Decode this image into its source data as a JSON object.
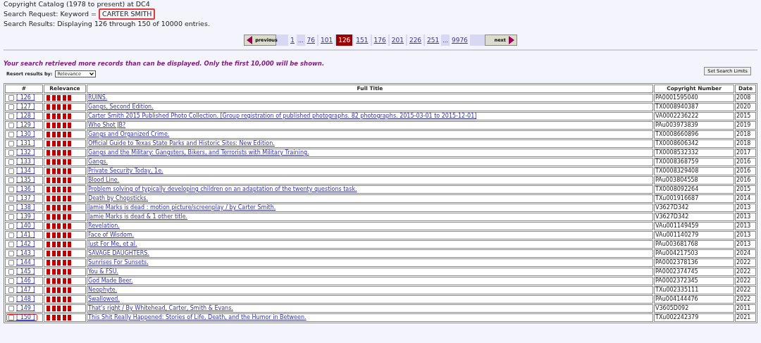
{
  "header": {
    "catalog": "Copyright Catalog (1978 to present) at DC4",
    "request_label": "Search Request: Keyword =",
    "keyword": "CARTER SMITH",
    "keyword_highlighted": true,
    "results": "Search Results: Displaying 126 through 150 of 10000 entries."
  },
  "pagination": {
    "previous": "previous",
    "next": "next",
    "pages": [
      {
        "label": "1",
        "kind": "link",
        "selected": false
      },
      {
        "label": "...",
        "kind": "gap"
      },
      {
        "label": "76",
        "kind": "link",
        "selected": false
      },
      {
        "label": "101",
        "kind": "link",
        "selected": false
      },
      {
        "label": "126",
        "kind": "link",
        "selected": true
      },
      {
        "label": "151",
        "kind": "link",
        "selected": false
      },
      {
        "label": "176",
        "kind": "link",
        "selected": false
      },
      {
        "label": "201",
        "kind": "link",
        "selected": false
      },
      {
        "label": "226",
        "kind": "link",
        "selected": false
      },
      {
        "label": "251",
        "kind": "link",
        "selected": false
      },
      {
        "label": "...",
        "kind": "gap"
      },
      {
        "label": "9976",
        "kind": "link",
        "selected": false
      }
    ]
  },
  "notice": "Your search retrieved more records than can be displayed. Only the first 10,000 will be shown.",
  "resort": {
    "label": "Resort results by:",
    "value": "Relevance"
  },
  "limits_button": "Set Search Limits",
  "table": {
    "columns": [
      "#",
      "Relevance",
      "Full Title",
      "Copyright Number",
      "Date"
    ],
    "rows": [
      {
        "num": "[ 126 ]",
        "checked": false,
        "highlighted": false,
        "stars": 5,
        "title": "RUINS.",
        "number": "PA0001595040",
        "date": "2008"
      },
      {
        "num": "[ 127 ]",
        "checked": false,
        "highlighted": false,
        "stars": 5,
        "title": "Gangs, Second Edition.",
        "number": "TX0008940387",
        "date": "2020"
      },
      {
        "num": "[ 128 ]",
        "checked": false,
        "highlighted": false,
        "stars": 5,
        "title": "Carter Smith 2015 Published Photo Collection. [Group registration of published photographs. 82 photographs. 2015-03-01 to 2015-12-01]",
        "number": "VA0002236222",
        "date": "2015"
      },
      {
        "num": "[ 129 ]",
        "checked": false,
        "highlighted": false,
        "stars": 5,
        "title": "Who Shot JB?",
        "number": "PAu003973839",
        "date": "2019"
      },
      {
        "num": "[ 130 ]",
        "checked": false,
        "highlighted": false,
        "stars": 5,
        "title": "Gangs and Organized Crime.",
        "number": "TX0008660896",
        "date": "2018"
      },
      {
        "num": "[ 131 ]",
        "checked": false,
        "highlighted": false,
        "stars": 5,
        "title": "Official Guide to Texas State Parks and Historic Sites: New Edition.",
        "number": "TX0008606342",
        "date": "2018"
      },
      {
        "num": "[ 132 ]",
        "checked": false,
        "highlighted": false,
        "stars": 5,
        "title": "Gangs and the Military: Gangsters, Bikers, and Terrorists with Military Training.",
        "number": "TX0008532332",
        "date": "2017"
      },
      {
        "num": "[ 133 ]",
        "checked": false,
        "highlighted": false,
        "stars": 5,
        "title": "Gangs.",
        "number": "TX0008368759",
        "date": "2016"
      },
      {
        "num": "[ 134 ]",
        "checked": false,
        "highlighted": false,
        "stars": 5,
        "title": "Private Security Today, 1e.",
        "number": "TX0008329408",
        "date": "2016"
      },
      {
        "num": "[ 135 ]",
        "checked": false,
        "highlighted": false,
        "stars": 5,
        "title": "Blood Line.",
        "number": "PAu003804558",
        "date": "2016"
      },
      {
        "num": "[ 136 ]",
        "checked": false,
        "highlighted": false,
        "stars": 5,
        "title": "Problem solving of typically developing children on an adaptation of the twenty questions task.",
        "number": "TX0008092264",
        "date": "2015"
      },
      {
        "num": "[ 137 ]",
        "checked": false,
        "highlighted": false,
        "stars": 5,
        "title": "Death by Chopsticks.",
        "number": "TXu001916687",
        "date": "2014"
      },
      {
        "num": "[ 138 ]",
        "checked": false,
        "highlighted": false,
        "stars": 5,
        "title": "Jamie Marks is dead : motion picture/screenplay / by Carter Smith.",
        "number": "V3627D342",
        "date": "2013"
      },
      {
        "num": "[ 139 ]",
        "checked": false,
        "highlighted": false,
        "stars": 5,
        "title": "Jamie Marks is dead & 1 other title.",
        "number": "V3627D342",
        "date": "2013"
      },
      {
        "num": "[ 140 ]",
        "checked": false,
        "highlighted": false,
        "stars": 5,
        "title": "Revelation.",
        "number": "VAu001149459",
        "date": "2013"
      },
      {
        "num": "[ 141 ]",
        "checked": false,
        "highlighted": false,
        "stars": 5,
        "title": "Face of Wisdom.",
        "number": "VAu001140279",
        "date": "2013"
      },
      {
        "num": "[ 142 ]",
        "checked": false,
        "highlighted": false,
        "stars": 5,
        "title": "Just For Me, et al.",
        "number": "PAu003681768",
        "date": "2013"
      },
      {
        "num": "[ 143 ]",
        "checked": false,
        "highlighted": false,
        "stars": 5,
        "title": "SAVAGE DAUGHTERS.",
        "number": "PAu004217503",
        "date": "2024"
      },
      {
        "num": "[ 144 ]",
        "checked": false,
        "highlighted": false,
        "stars": 5,
        "title": "Sunrises For Sunsets.",
        "number": "PA0002378136",
        "date": "2022"
      },
      {
        "num": "[ 145 ]",
        "checked": false,
        "highlighted": false,
        "stars": 5,
        "title": "You & FSU.",
        "number": "PA0002374745",
        "date": "2022"
      },
      {
        "num": "[ 146 ]",
        "checked": false,
        "highlighted": false,
        "stars": 5,
        "title": "God Made Beer.",
        "number": "PA0002372345",
        "date": "2022"
      },
      {
        "num": "[ 147 ]",
        "checked": false,
        "highlighted": false,
        "stars": 5,
        "title": "Neophyte.",
        "number": "TXu002335111",
        "date": "2022"
      },
      {
        "num": "[ 148 ]",
        "checked": false,
        "highlighted": false,
        "stars": 5,
        "title": "Swallowed.",
        "number": "PAu004144476",
        "date": "2022"
      },
      {
        "num": "[ 149 ]",
        "checked": false,
        "highlighted": false,
        "stars": 5,
        "title": "That's right / By Whitehead, Carter, Smith & Evans.",
        "number": "V3605D092",
        "date": "2011"
      },
      {
        "num": "[ 150 ]",
        "checked": false,
        "highlighted": true,
        "stars": 5,
        "title": "This Shit Really Happened: Stories of Life, Death, and the Humor in Between.",
        "number": "TXu002242379",
        "date": "2021"
      }
    ]
  }
}
